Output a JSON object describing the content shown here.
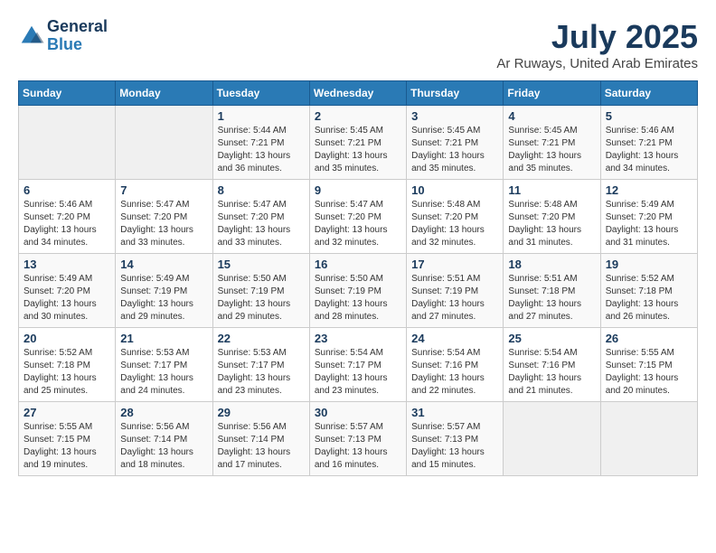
{
  "logo": {
    "line1": "General",
    "line2": "Blue"
  },
  "title": "July 2025",
  "subtitle": "Ar Ruways, United Arab Emirates",
  "weekdays": [
    "Sunday",
    "Monday",
    "Tuesday",
    "Wednesday",
    "Thursday",
    "Friday",
    "Saturday"
  ],
  "weeks": [
    [
      {
        "day": "",
        "info": ""
      },
      {
        "day": "",
        "info": ""
      },
      {
        "day": "1",
        "info": "Sunrise: 5:44 AM\nSunset: 7:21 PM\nDaylight: 13 hours and 36 minutes."
      },
      {
        "day": "2",
        "info": "Sunrise: 5:45 AM\nSunset: 7:21 PM\nDaylight: 13 hours and 35 minutes."
      },
      {
        "day": "3",
        "info": "Sunrise: 5:45 AM\nSunset: 7:21 PM\nDaylight: 13 hours and 35 minutes."
      },
      {
        "day": "4",
        "info": "Sunrise: 5:45 AM\nSunset: 7:21 PM\nDaylight: 13 hours and 35 minutes."
      },
      {
        "day": "5",
        "info": "Sunrise: 5:46 AM\nSunset: 7:21 PM\nDaylight: 13 hours and 34 minutes."
      }
    ],
    [
      {
        "day": "6",
        "info": "Sunrise: 5:46 AM\nSunset: 7:20 PM\nDaylight: 13 hours and 34 minutes."
      },
      {
        "day": "7",
        "info": "Sunrise: 5:47 AM\nSunset: 7:20 PM\nDaylight: 13 hours and 33 minutes."
      },
      {
        "day": "8",
        "info": "Sunrise: 5:47 AM\nSunset: 7:20 PM\nDaylight: 13 hours and 33 minutes."
      },
      {
        "day": "9",
        "info": "Sunrise: 5:47 AM\nSunset: 7:20 PM\nDaylight: 13 hours and 32 minutes."
      },
      {
        "day": "10",
        "info": "Sunrise: 5:48 AM\nSunset: 7:20 PM\nDaylight: 13 hours and 32 minutes."
      },
      {
        "day": "11",
        "info": "Sunrise: 5:48 AM\nSunset: 7:20 PM\nDaylight: 13 hours and 31 minutes."
      },
      {
        "day": "12",
        "info": "Sunrise: 5:49 AM\nSunset: 7:20 PM\nDaylight: 13 hours and 31 minutes."
      }
    ],
    [
      {
        "day": "13",
        "info": "Sunrise: 5:49 AM\nSunset: 7:20 PM\nDaylight: 13 hours and 30 minutes."
      },
      {
        "day": "14",
        "info": "Sunrise: 5:49 AM\nSunset: 7:19 PM\nDaylight: 13 hours and 29 minutes."
      },
      {
        "day": "15",
        "info": "Sunrise: 5:50 AM\nSunset: 7:19 PM\nDaylight: 13 hours and 29 minutes."
      },
      {
        "day": "16",
        "info": "Sunrise: 5:50 AM\nSunset: 7:19 PM\nDaylight: 13 hours and 28 minutes."
      },
      {
        "day": "17",
        "info": "Sunrise: 5:51 AM\nSunset: 7:19 PM\nDaylight: 13 hours and 27 minutes."
      },
      {
        "day": "18",
        "info": "Sunrise: 5:51 AM\nSunset: 7:18 PM\nDaylight: 13 hours and 27 minutes."
      },
      {
        "day": "19",
        "info": "Sunrise: 5:52 AM\nSunset: 7:18 PM\nDaylight: 13 hours and 26 minutes."
      }
    ],
    [
      {
        "day": "20",
        "info": "Sunrise: 5:52 AM\nSunset: 7:18 PM\nDaylight: 13 hours and 25 minutes."
      },
      {
        "day": "21",
        "info": "Sunrise: 5:53 AM\nSunset: 7:17 PM\nDaylight: 13 hours and 24 minutes."
      },
      {
        "day": "22",
        "info": "Sunrise: 5:53 AM\nSunset: 7:17 PM\nDaylight: 13 hours and 23 minutes."
      },
      {
        "day": "23",
        "info": "Sunrise: 5:54 AM\nSunset: 7:17 PM\nDaylight: 13 hours and 23 minutes."
      },
      {
        "day": "24",
        "info": "Sunrise: 5:54 AM\nSunset: 7:16 PM\nDaylight: 13 hours and 22 minutes."
      },
      {
        "day": "25",
        "info": "Sunrise: 5:54 AM\nSunset: 7:16 PM\nDaylight: 13 hours and 21 minutes."
      },
      {
        "day": "26",
        "info": "Sunrise: 5:55 AM\nSunset: 7:15 PM\nDaylight: 13 hours and 20 minutes."
      }
    ],
    [
      {
        "day": "27",
        "info": "Sunrise: 5:55 AM\nSunset: 7:15 PM\nDaylight: 13 hours and 19 minutes."
      },
      {
        "day": "28",
        "info": "Sunrise: 5:56 AM\nSunset: 7:14 PM\nDaylight: 13 hours and 18 minutes."
      },
      {
        "day": "29",
        "info": "Sunrise: 5:56 AM\nSunset: 7:14 PM\nDaylight: 13 hours and 17 minutes."
      },
      {
        "day": "30",
        "info": "Sunrise: 5:57 AM\nSunset: 7:13 PM\nDaylight: 13 hours and 16 minutes."
      },
      {
        "day": "31",
        "info": "Sunrise: 5:57 AM\nSunset: 7:13 PM\nDaylight: 13 hours and 15 minutes."
      },
      {
        "day": "",
        "info": ""
      },
      {
        "day": "",
        "info": ""
      }
    ]
  ]
}
